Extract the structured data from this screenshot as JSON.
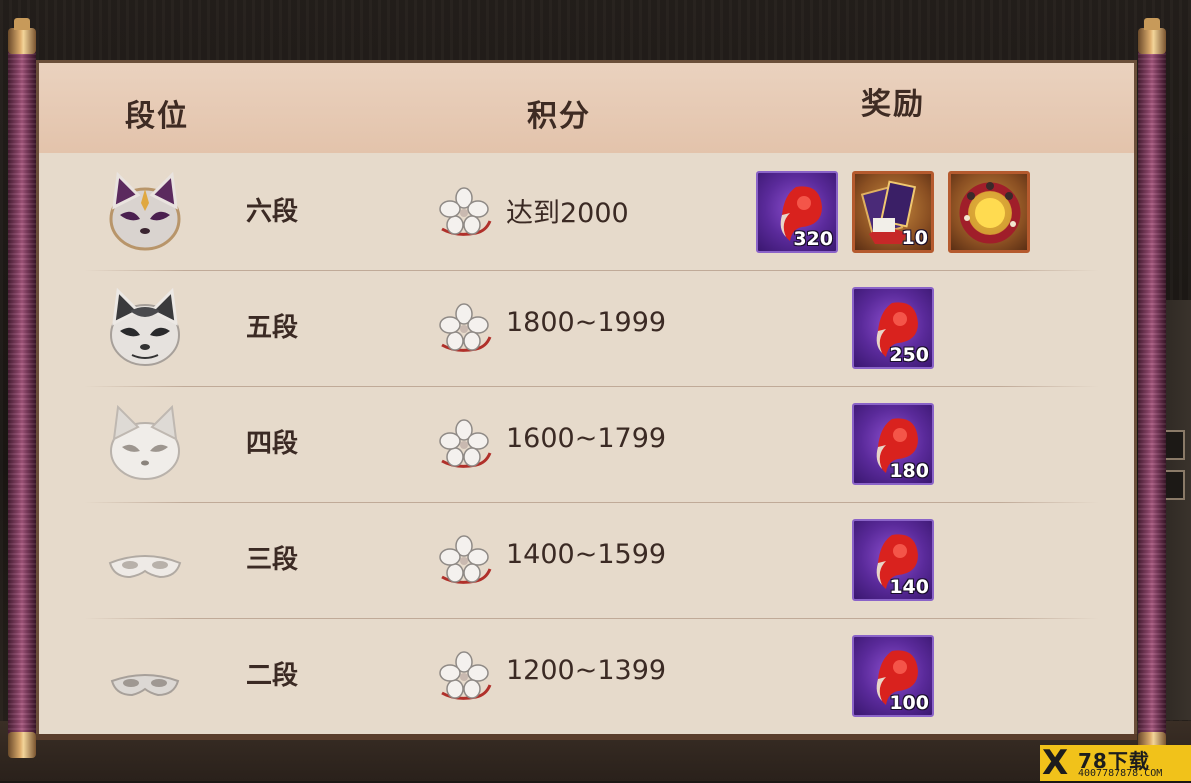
{
  "header": {
    "rank_label": "段位",
    "score_label": "积分",
    "reward_label": "奖励"
  },
  "rows": [
    {
      "rank": "六段",
      "mask": "purple-fox-mask-icon",
      "score": "达到2000",
      "rewards": [
        {
          "icon": "red-magatama-icon",
          "qty": "320",
          "frame": "purple"
        },
        {
          "icon": "rank-banner-icon",
          "qty": "10",
          "frame": "gold"
        },
        {
          "icon": "golden-wreath-icon",
          "qty": "",
          "frame": "gold"
        }
      ]
    },
    {
      "rank": "五段",
      "mask": "black-white-fox-mask-icon",
      "score": "1800~1999",
      "rewards": [
        {
          "icon": "red-magatama-icon",
          "qty": "250",
          "frame": "purple"
        }
      ]
    },
    {
      "rank": "四段",
      "mask": "white-fox-mask-icon",
      "score": "1600~1799",
      "rewards": [
        {
          "icon": "red-magatama-icon",
          "qty": "180",
          "frame": "purple"
        }
      ]
    },
    {
      "rank": "三段",
      "mask": "white-half-mask-icon",
      "score": "1400~1599",
      "rewards": [
        {
          "icon": "red-magatama-icon",
          "qty": "140",
          "frame": "purple"
        }
      ]
    },
    {
      "rank": "二段",
      "mask": "silver-half-mask-icon",
      "score": "1200~1399",
      "rewards": [
        {
          "icon": "red-magatama-icon",
          "qty": "100",
          "frame": "purple"
        }
      ]
    }
  ],
  "score_icon": "sakura-flower-icon",
  "watermark": {
    "mark": "X",
    "brand": "78下载",
    "site": "4007787878.COM"
  },
  "colors": {
    "parchment": "#e6dacb",
    "header_band": "#e6c8b2",
    "text": "#3b2a24",
    "rod": "#8a4468",
    "purple_frame": "#5a2a9a",
    "gold_frame": "#b55a2e",
    "watermark": "#f1c21a"
  }
}
